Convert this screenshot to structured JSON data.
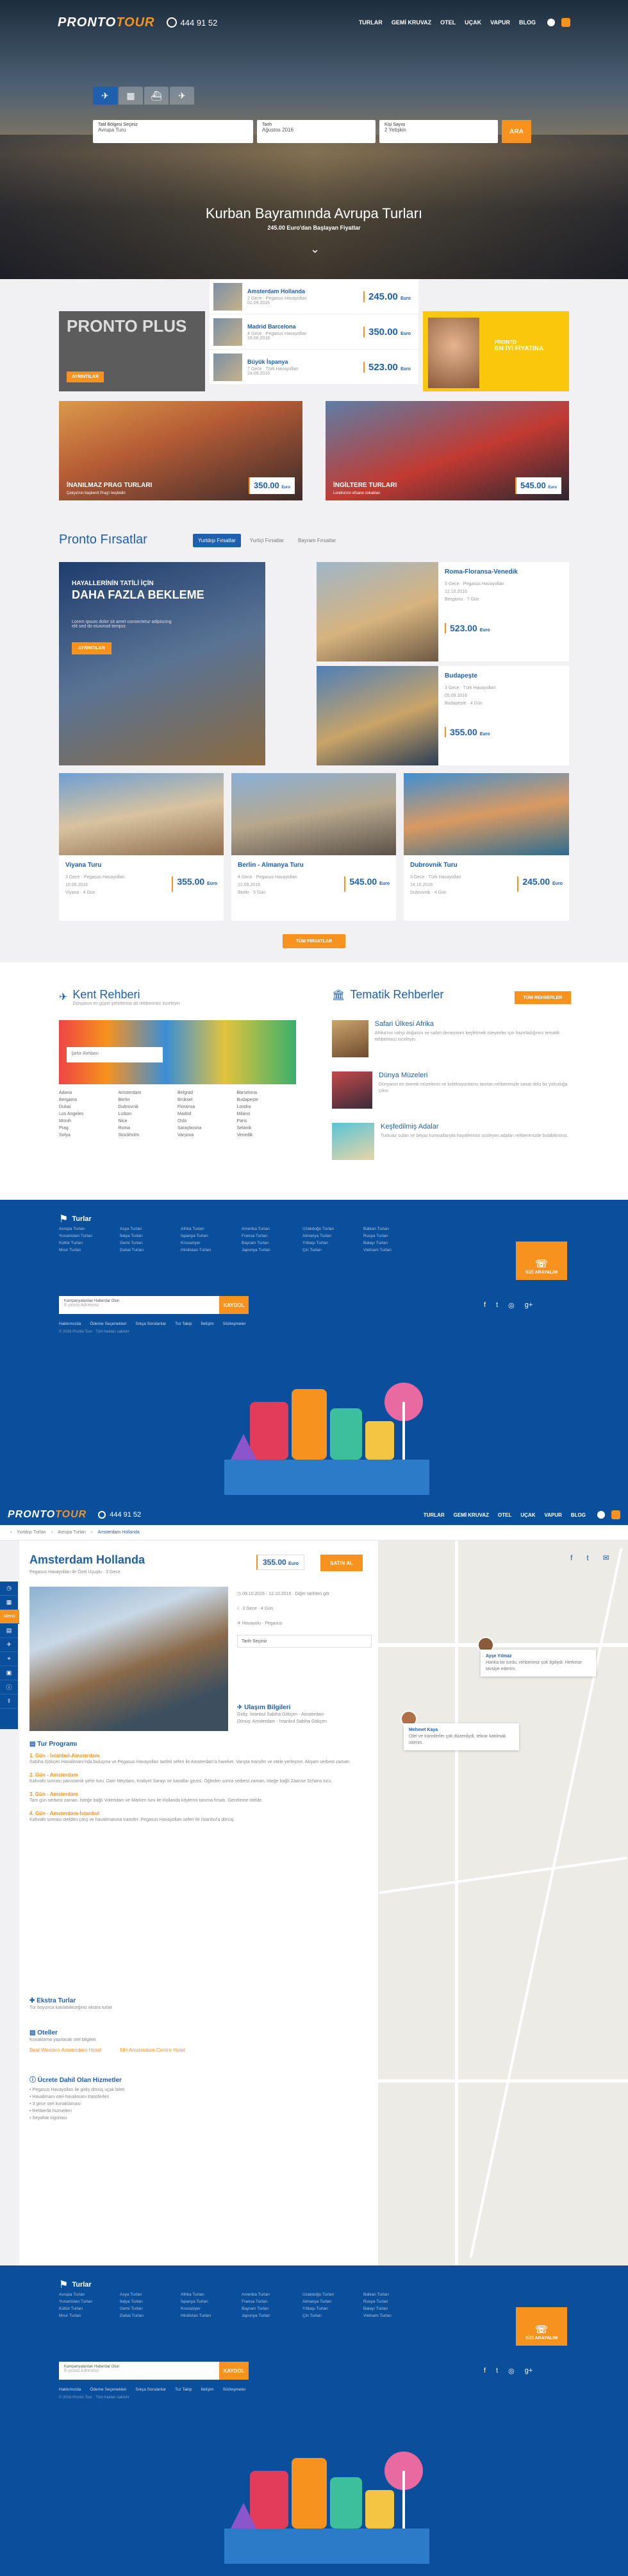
{
  "nav": {
    "logo_a": "PRONTO",
    "logo_b": "TOUR",
    "phone": "444 91 52",
    "menu": [
      "TURLAR",
      "GEMİ KRUVAZ",
      "OTEL",
      "UÇAK",
      "VAPUR",
      "BLOG"
    ]
  },
  "hero": {
    "search": {
      "f1_label": "Tatil Bölgesi Seçiniz",
      "f1_value": "Avrupa Turu",
      "f2_label": "Tarih",
      "f2_value": "Ağustos 2016",
      "f3_label": "Kişi Sayısı",
      "f3_value": "2 Yetişkin",
      "button": "ARA"
    },
    "title": "Kurban Bayramında Avrupa Turları",
    "subtitle": "245.00 Euro'dan Başlayan Fiyatlar"
  },
  "featured": [
    {
      "name": "Amsterdam Hollanda",
      "meta": "2 Gece · Pegasus Havayolları",
      "date": "01.09.2016",
      "price": "245.00",
      "cur": "Euro"
    },
    {
      "name": "Madrid Barcelona",
      "meta": "4 Gece · Pegasus Havayolları",
      "date": "18.08.2016",
      "price": "350.00",
      "cur": "Euro"
    },
    {
      "name": "Büyük İspanya",
      "meta": "7 Gece · Türk Havayolları",
      "date": "24.09.2016",
      "price": "523.00",
      "cur": "Euro"
    }
  ],
  "promos": {
    "plus_title": "PRONTO PLUS",
    "plus_btn": "AYRINTILAR",
    "yellow_brand": "PRONTO",
    "yellow_text": "EN İYİ FİYATINA",
    "tile1_title": "İNANILMAZ PRAG TURLARI",
    "tile1_sub": "Çekya'nın başkenti Prag'ı keşfedin",
    "tile1_price": "350.00",
    "tile1_cur": "Euro",
    "tile2_title": "İNGİLTERE TURLARI",
    "tile2_sub": "Londra'nın efsane sokakları",
    "tile2_price": "545.00",
    "tile2_cur": "Euro"
  },
  "firsatlar": {
    "title": "Pronto Fırsatlar",
    "tabs": [
      "Yurtdışı Fırsatlar",
      "Yurtiçi Fırsatlar",
      "Bayram Fırsatlar"
    ],
    "big": {
      "t1": "HAYALLERİNİN TATİLİ İÇİN",
      "t2": "DAHA FAZLA BEKLEME",
      "t3": "Lorem ipsum dolor sit amet consectetur adipiscing elit sed do eiusmod tempor.",
      "btn": "AYRINTILAR"
    },
    "right": [
      {
        "name": "Roma-Floransa-Venedik",
        "meta": "5 Gece · Pegasus Havayolları",
        "date": "12.10.2016",
        "route": "Bergamo · 7 Gün",
        "price": "523.00",
        "cur": "Euro"
      },
      {
        "name": "Budapeşte",
        "meta": "3 Gece · Türk Havayolları",
        "date": "05.09.2016",
        "route": "Budapeşte · 4 Gün",
        "price": "355.00",
        "cur": "Euro"
      }
    ],
    "bottom": [
      {
        "name": "Viyana Turu",
        "meta": "3 Gece · Pegasus Havayolları",
        "date": "10.09.2016",
        "route": "Viyana · 4 Gün",
        "price": "355.00",
        "cur": "Euro"
      },
      {
        "name": "Berlin - Almanya Turu",
        "meta": "4 Gece · Pegasus Havayolları",
        "date": "22.09.2016",
        "route": "Berlin · 5 Gün",
        "price": "545.00",
        "cur": "Euro"
      },
      {
        "name": "Dubrovnik Turu",
        "meta": "3 Gece · Türk Havayolları",
        "date": "14.10.2016",
        "route": "Dubrovnik · 4 Gün",
        "price": "245.00",
        "cur": "Euro"
      }
    ],
    "all_btn": "TÜM FIRSATLAR"
  },
  "guides": {
    "city_title": "Kent Rehberi",
    "city_sub": "Dünyanın en güzel şehirlerine ait rehberimizi inceleyin",
    "city_search": "Şehir Rehberi",
    "cities": [
      "Adana",
      "Amsterdam",
      "Belgrad",
      "Barselona",
      "Bergamo",
      "Berlin",
      "Brüksel",
      "Budapeşte",
      "Dubai",
      "Dubrovnik",
      "Floransa",
      "Londra",
      "Los Angeles",
      "Lizbon",
      "Madrid",
      "Milano",
      "Münih",
      "Nice",
      "Oslo",
      "Paris",
      "Prag",
      "Roma",
      "Saraybosna",
      "Selanik",
      "Sofya",
      "Stockholm",
      "Varşova",
      "Venedik"
    ],
    "theme_title": "Tematik Rehberler",
    "theme_btn": "TÜM REHBERLER",
    "themes": [
      {
        "t": "Safari Ülkesi Afrika",
        "d": "Afrika'nın vahşi doğasını ve safari deneyimini keşfetmek isteyenler için hazırladığımız tematik rehberimizi inceleyin."
      },
      {
        "t": "Dünya Müzeleri",
        "d": "Dünyanın en önemli müzelerini ve koleksiyonlarını tanıtan rehberimizle sanat dolu bir yolculuğa çıkın."
      },
      {
        "t": "Keşfedilmiş Adalar",
        "d": "Turkuaz suları ve beyaz kumsallarıyla hayallerinizi süsleyen adaları rehberimizde bulabilirsiniz."
      }
    ]
  },
  "footer": {
    "title": "Turlar",
    "links": [
      "Avrupa Turları",
      "Asya Turları",
      "Afrika Turları",
      "Amerika Turları",
      "Uzakdoğu Turları",
      "Balkan Turları",
      "Yunanistan Turları",
      "İtalya Turları",
      "İspanya Turları",
      "Fransa Turları",
      "Almanya Turları",
      "Rusya Turları",
      "Kültür Turları",
      "Gemi Turları",
      "Kruvaziyer",
      "Bayram Turları",
      "Yılbaşı Turları",
      "Balayı Turları",
      "Mısır Turları",
      "Dubai Turları",
      "Hindistan Turları",
      "Japonya Turları",
      "Çin Turları",
      "Vietnam Turları"
    ],
    "call": "SİZİ ARAYALIM",
    "sub_label": "Kampanyalardan Haberdar Olun",
    "sub_placeholder": "E-posta Adresiniz",
    "sub_btn": "KAYDOL",
    "bottom_links": [
      "Hakkımızda",
      "Ödeme Seçenekleri",
      "Sıkça Sorulanlar",
      "Tur Takip",
      "İletişim",
      "Sözleşmeler"
    ],
    "copy": "© 2016 Pronto Tour · Tüm hakları saklıdır"
  },
  "detail": {
    "crumbs": [
      "Yurtdışı Turları",
      "Avrupa Turları",
      "Amsterdam Hollanda"
    ],
    "title": "Amsterdam Hollanda",
    "subtitle": "Pegasus Havayolları ile Özel Uçuşlu · 3 Gece",
    "price": "355.00",
    "cur": "Euro",
    "buy": "SATIN AL",
    "facts": [
      "09.10.2016 - 12.10.2016 · Diğer tarihleri gör",
      "3 Gece · 4 Gün",
      "Havayolu · Pegasus"
    ],
    "dates_select": "Tarih Seçiniz",
    "flight_title": "Ulaşım Bilgileri",
    "flight_lines": [
      "Gidiş: İstanbul Sabiha Gökçen - Amsterdam",
      "Dönüş: Amsterdam - İstanbul Sabiha Gökçen"
    ],
    "program_title": "Tur Programı",
    "days": [
      {
        "h": "1. Gün - İstanbul-Amsterdam",
        "d": "Sabiha Gökçen Havalimanı'nda buluşma ve Pegasus Havayolları tarifeli seferi ile Amsterdam'a hareket. Varışta transfer ve otele yerleşme. Akşam serbest zaman."
      },
      {
        "h": "2. Gün - Amsterdam",
        "d": "Kahvaltı sonrası panoramik şehir turu. Dam Meydanı, Kraliyet Sarayı ve kanallar gezisi. Öğleden sonra serbest zaman, isteğe bağlı Zaanse Schans turu."
      },
      {
        "h": "3. Gün - Amsterdam",
        "d": "Tam gün serbest zaman. İsteğe bağlı Volendam ve Marken turu ile Hollanda köylerini tanıma fırsatı. Geceleme otelde."
      },
      {
        "h": "4. Gün - Amsterdam-İstanbul",
        "d": "Kahvaltı sonrası otelden çıkış ve havalimanına transfer. Pegasus Havayolları seferi ile İstanbul'a dönüş."
      }
    ],
    "extra_title": "Ekstra Turlar",
    "extra_sub": "Tur boyunca katılabileceğiniz ekstra turlar",
    "hotel_title": "Oteller",
    "hotel_sub": "Konaklama yapılacak otel bilgileri",
    "hotels": [
      "Best Western Amsterdam Hotel",
      "NH Amsterdam Centre Hotel"
    ],
    "excluded_title": "Ücrete Dahil Olan Hizmetler",
    "excluded": [
      "Pegasus Havayolları ile gidiş-dönüş uçak bileti",
      "Havalimanı-otel-havalimanı transferleri",
      "3 gece otel konaklaması",
      "Rehberlik hizmetleri",
      "Seyahat sigortası"
    ],
    "reviews": [
      {
        "name": "Ayşe Yılmaz",
        "text": "Harika bir turdu, rehberimiz çok ilgiliydi. Herkese tavsiye ederim."
      },
      {
        "name": "Mehmet Kaya",
        "text": "Otel ve transferler çok düzenliydi, tekrar katılmak isterim."
      }
    ],
    "side": [
      "Menü"
    ]
  }
}
